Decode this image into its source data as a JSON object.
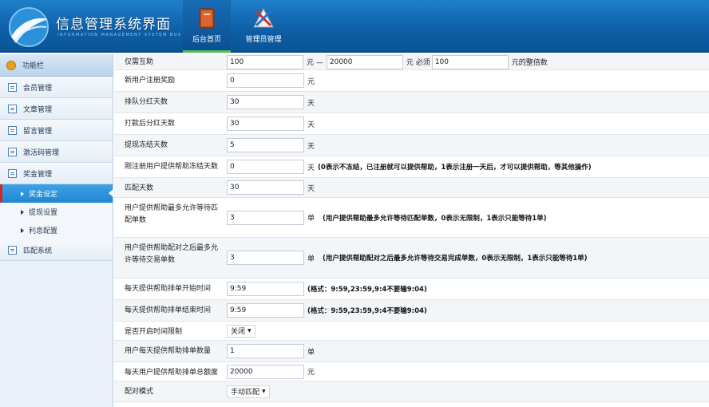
{
  "header": {
    "title": "信息管理系统界面",
    "subtitle": "INFORMATION MANAGEMENT SYSTEM BOX",
    "tabs": [
      {
        "label": "后台首页",
        "icon": "book-icon",
        "active": true
      },
      {
        "label": "管理员管理",
        "icon": "tools-icon",
        "active": false
      }
    ]
  },
  "sidebar": {
    "header": "功能栏",
    "items": [
      {
        "label": "会员管理"
      },
      {
        "label": "文章管理"
      },
      {
        "label": "留言管理"
      },
      {
        "label": "激活码管理"
      },
      {
        "label": "奖金管理"
      }
    ],
    "subitems": [
      {
        "label": "奖金设定",
        "active": true
      },
      {
        "label": "提现设置",
        "active": false
      },
      {
        "label": "利息配置",
        "active": false
      }
    ],
    "last_item": {
      "label": "匹配系统"
    }
  },
  "form": {
    "row1": {
      "label": "仅需互助",
      "min": "100",
      "sep": "元 —",
      "max": "20000",
      "unit1": "元 必须",
      "multiple": "100",
      "unit2": "元的整倍数"
    },
    "row2": {
      "label": "新用户注册奖励",
      "value": "0",
      "unit": "元"
    },
    "row3": {
      "label": "排队分红天数",
      "value": "30",
      "unit": "天"
    },
    "row4": {
      "label": "打款后分红天数",
      "value": "30",
      "unit": "天"
    },
    "row5": {
      "label": "提现冻结天数",
      "value": "5",
      "unit": "天"
    },
    "row6": {
      "label": "刚注册用户提供帮助冻结天数",
      "value": "0",
      "unit": "天",
      "hint": "(0表示不冻结，已注册就可以提供帮助，1表示注册一天后，才可以提供帮助，等其他操作)"
    },
    "row7": {
      "label": "匹配天数",
      "value": "30",
      "unit": "天"
    },
    "row8": {
      "label": "用户提供帮助最多允许等待匹配单数",
      "value": "3",
      "unit": "单",
      "hint": "(用户提供帮助最多允许等待匹配单数，0表示无限制，1表示只能等待1单)"
    },
    "row9": {
      "label": "用户提供帮助配对之后最多允许等待交易单数",
      "value": "3",
      "unit": "单",
      "hint": "(用户提供帮助配对之后最多允许等待交易完成单数，0表示无限制，1表示只能等待1单)"
    },
    "row10": {
      "label": "每天提供帮助排单开始时间",
      "value": "9:59",
      "hint": "(格式：9:59,23:59,9:4不要输9:04)"
    },
    "row11": {
      "label": "每天提供帮助排单结束时间",
      "value": "9:59",
      "hint": "(格式：9:59,23:59,9:4不要输9:04)"
    },
    "row12": {
      "label": "是否开启时间限制",
      "value": "关闭"
    },
    "row13": {
      "label": "用户每天提供帮助排单数量",
      "value": "1",
      "unit": "单"
    },
    "row14": {
      "label": "每天用户提供帮助排单总额度",
      "value": "20000",
      "unit": "元"
    },
    "row15": {
      "label": "配对模式",
      "value": "手动匹配"
    }
  }
}
